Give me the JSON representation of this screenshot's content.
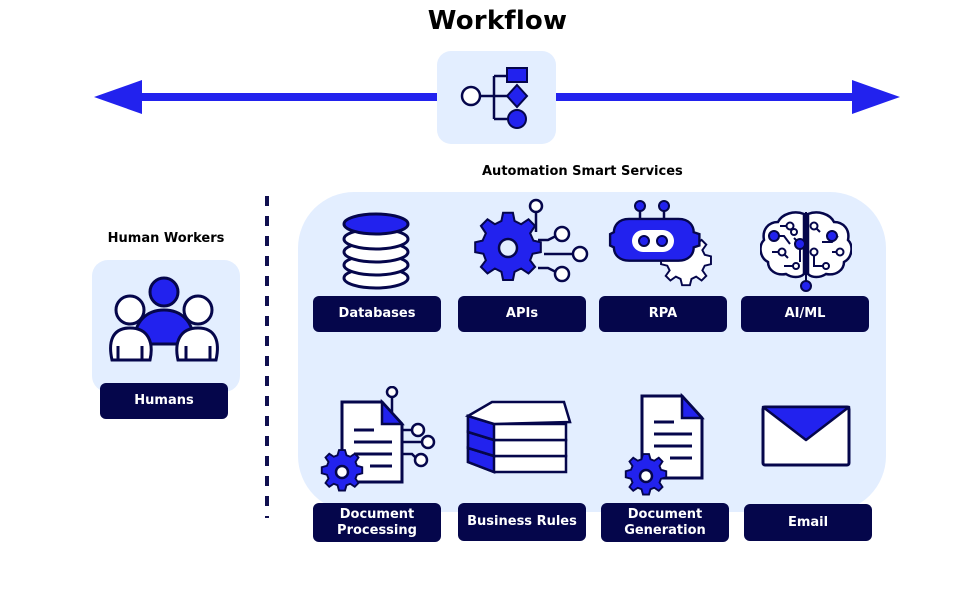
{
  "diagram": {
    "title": "Workflow",
    "colors": {
      "accent": "#2222ee",
      "navy": "#05064b",
      "panel_bg": "#e3eeff",
      "white": "#ffffff"
    },
    "workflow_axis": {
      "direction": "bidirectional",
      "icon": "workflow-flowchart-icon"
    },
    "human_workers": {
      "heading": "Human Workers",
      "items": [
        {
          "label": "Humans",
          "icon": "people-group-icon"
        }
      ]
    },
    "automation": {
      "heading": "Automation Smart Services",
      "items": [
        {
          "label": "Databases",
          "icon": "database-icon"
        },
        {
          "label": "APIs",
          "icon": "api-gear-icon"
        },
        {
          "label": "RPA",
          "icon": "robot-icon"
        },
        {
          "label": "AI/ML",
          "icon": "brain-icon"
        },
        {
          "label_line1": "Document",
          "label_line2": "Processing",
          "icon": "document-processing-icon"
        },
        {
          "label": "Business Rules",
          "icon": "books-icon"
        },
        {
          "label_line1": "Document",
          "label_line2": "Generation",
          "icon": "document-generation-icon"
        },
        {
          "label": "Email",
          "icon": "envelope-icon"
        }
      ]
    }
  }
}
